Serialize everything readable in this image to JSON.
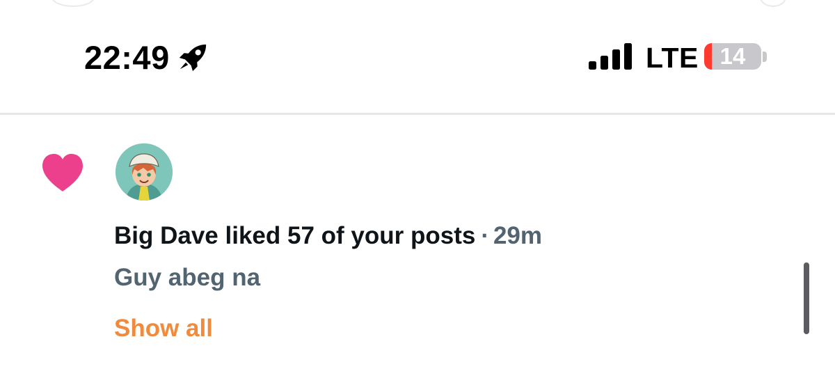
{
  "status_bar": {
    "time": "22:49",
    "activity_icon": "rocket-icon",
    "signal_icon": "cellular-signal-icon",
    "signal_bars": 4,
    "network": "LTE",
    "battery_level": "14",
    "battery_fill_fraction": 0.14
  },
  "notification": {
    "type_icon": "heart-icon",
    "avatar_icon": "user-avatar",
    "message": "Big Dave liked 57 of your posts",
    "separator": "·",
    "time_ago": "29m",
    "post_preview": "Guy abeg na",
    "show_all_label": "Show all"
  },
  "colors": {
    "heart": "#ec3f8c",
    "show_all": "#f08a3c",
    "secondary_text": "#536471",
    "battery_low": "#ff3b30",
    "battery_body": "#c7c7cc"
  }
}
